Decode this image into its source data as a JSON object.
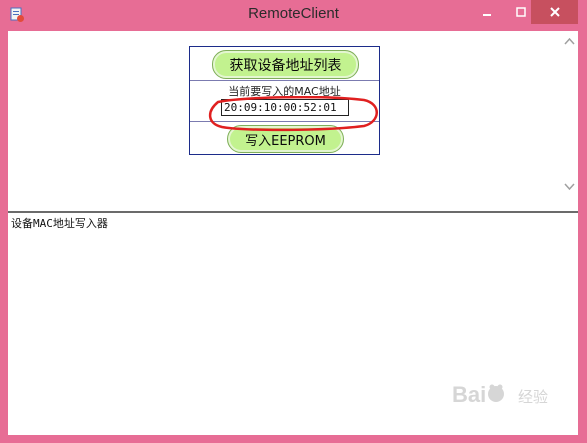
{
  "window": {
    "title": "RemoteClient"
  },
  "form": {
    "get_list_button": "获取设备地址列表",
    "mac_label": "当前要写入的MAC地址",
    "mac_value": "20:09:10:00:52:01",
    "write_button": "写入EEPROM"
  },
  "log": {
    "lines": [
      "设备MAC地址写入器"
    ]
  },
  "watermark": {
    "text": "Baidu 经验"
  },
  "colors": {
    "frame": "#e76d95",
    "button_fill": "#c2f28f",
    "annotation": "#e02020"
  },
  "icons": [
    "app-icon",
    "minimize-icon",
    "maximize-icon",
    "close-icon",
    "scroll-down-arrow-icon"
  ]
}
